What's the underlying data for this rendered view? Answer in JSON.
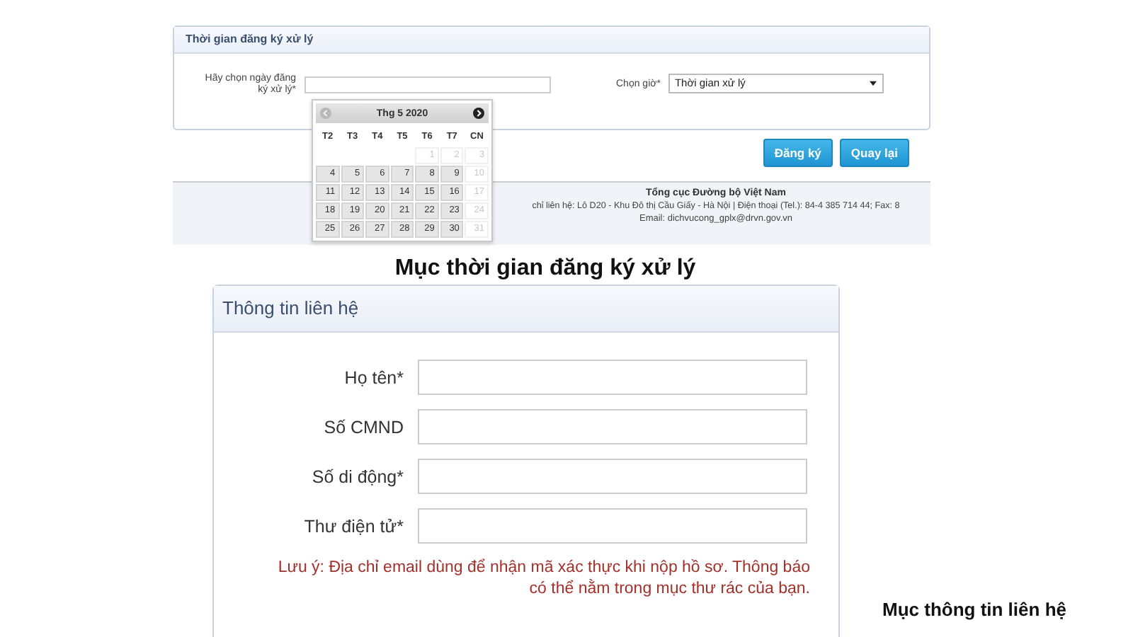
{
  "registration_panel": {
    "title": "Thời gian đăng ký xử lý",
    "date_label": "Hãy chọn ngày đăng ký xử lý*",
    "time_label": "Chọn giờ*",
    "time_select": {
      "value": "Thời gian xử lý"
    },
    "buttons": [
      "Đăng ký",
      "Quay lại"
    ],
    "calendar": {
      "month": "Thg 5 2020",
      "prev_disabled": true,
      "weekdays": [
        "T2",
        "T3",
        "T4",
        "T5",
        "T6",
        "T7",
        "CN"
      ],
      "weeks": [
        [
          {
            "day": "1",
            "disabled": true
          },
          {
            "day": "2",
            "disabled": true
          },
          {
            "day": "3",
            "disabled": true
          }
        ],
        [
          {
            "day": "4",
            "disabled": false
          },
          {
            "day": "5",
            "disabled": false
          },
          {
            "day": "6",
            "disabled": false
          },
          {
            "day": "7",
            "disabled": false
          },
          {
            "day": "8",
            "disabled": false
          },
          {
            "day": "9",
            "disabled": false
          },
          {
            "day": "10",
            "disabled": true
          }
        ],
        [
          {
            "day": "11",
            "disabled": false
          },
          {
            "day": "12",
            "disabled": false
          },
          {
            "day": "13",
            "disabled": false
          },
          {
            "day": "14",
            "disabled": false
          },
          {
            "day": "15",
            "disabled": false
          },
          {
            "day": "16",
            "disabled": false
          },
          {
            "day": "17",
            "disabled": true
          }
        ],
        [
          {
            "day": "18",
            "disabled": false
          },
          {
            "day": "19",
            "disabled": false
          },
          {
            "day": "20",
            "disabled": false
          },
          {
            "day": "21",
            "disabled": false
          },
          {
            "day": "22",
            "disabled": false
          },
          {
            "day": "23",
            "disabled": false
          },
          {
            "day": "24",
            "disabled": true
          }
        ],
        [
          {
            "day": "25",
            "disabled": false
          },
          {
            "day": "26",
            "disabled": false
          },
          {
            "day": "27",
            "disabled": false
          },
          {
            "day": "28",
            "disabled": false
          },
          {
            "day": "29",
            "disabled": false
          },
          {
            "day": "30",
            "disabled": false
          },
          {
            "day": "31",
            "disabled": true
          }
        ]
      ]
    },
    "footer": {
      "org": "Tổng cục Đường bộ Việt Nam",
      "address": "chỉ liên hệ: Lô D20 - Khu Đô thị Cầu Giấy - Hà Nội | Điện thoại (Tel.): 84-4 385 714 44; Fax: 8",
      "email": "Email: dichvucong_gplx@drvn.gov.vn"
    }
  },
  "caption_1": "Mục thời gian đăng ký xử lý",
  "contact_panel": {
    "title": "Thông tin liên hệ",
    "fields": [
      {
        "label": "Họ tên*"
      },
      {
        "label": "Số CMND"
      },
      {
        "label": "Số di động*"
      },
      {
        "label": "Thư điện tử*"
      }
    ],
    "note": "Lưu ý: Địa chỉ email dùng để nhận mã xác thực khi nộp hồ sơ. Thông báo có thể nằm trong mục thư rác của bạn."
  },
  "caption_2": "Mục thông tin liên hệ"
}
